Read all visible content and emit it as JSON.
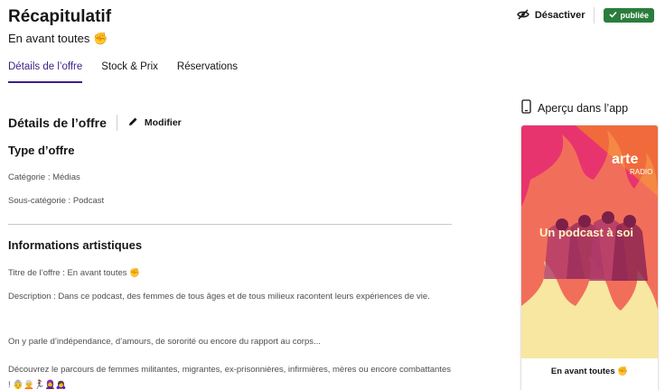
{
  "header": {
    "title": "Récapitulatif",
    "offer_name": "En avant toutes ✊",
    "deactivate_label": "Désactiver",
    "status_label": "publiée"
  },
  "tabs": [
    {
      "label": "Détails de l’offre",
      "active": true
    },
    {
      "label": "Stock & Prix",
      "active": false
    },
    {
      "label": "Réservations",
      "active": false
    }
  ],
  "details": {
    "section_title": "Détails de l’offre",
    "edit_label": "Modifier",
    "offer_type": {
      "title": "Type d’offre",
      "category": "Catégorie : Médias",
      "subcategory": "Sous-catégorie : Podcast"
    },
    "artistic": {
      "title": "Informations artistiques",
      "offer_title": "Titre de l’offre : En avant toutes ✊",
      "description_1": "Description : Dans ce podcast, des femmes de tous âges et de tous milieux racontent leurs expériences de vie.",
      "description_2": "On y parle d’indépendance, d’amours, de sororité ou encore du rapport au corps...",
      "description_3": "Découvrez le parcours de femmes militantes, migrantes, ex-prisonnières, infirmières, mères ou encore combattantes ! 👵🧑‍🦳🏃‍♀️🧕🙇‍♀️"
    }
  },
  "preview": {
    "header_label": "Aperçu dans l’app",
    "cover_brand": "arte",
    "cover_brand_sub": "RADIO",
    "cover_tagline": "Un podcast à soi",
    "card_title": "En avant toutes ✊"
  },
  "colors": {
    "accent": "#3d1f8a",
    "published": "#2b7d3c",
    "cover_pink": "#e8346e",
    "cover_yellow": "#f7e7a0"
  }
}
